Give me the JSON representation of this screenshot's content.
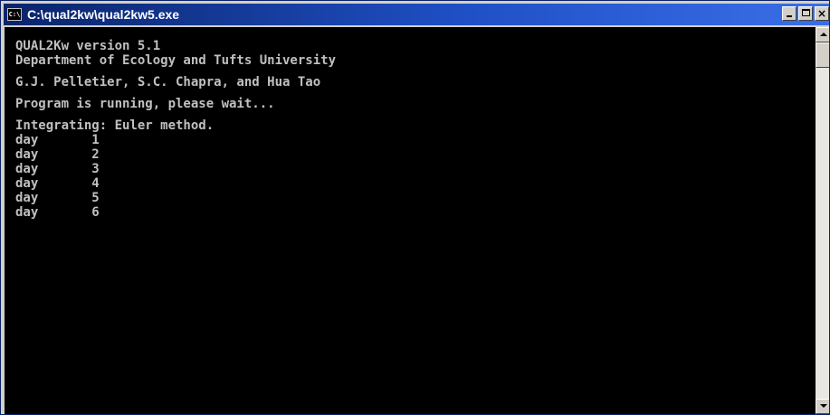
{
  "window": {
    "title": "C:\\qual2kw\\qual2kw5.exe",
    "icon_name": "console-icon",
    "icon_text": "C:\\",
    "close_glyph": "×"
  },
  "console": {
    "header": [
      "QUAL2Kw version 5.1",
      "Department of Ecology and Tufts University"
    ],
    "authors": "G.J. Pelletier, S.C. Chapra, and Hua Tao",
    "status": "Program is running, please wait...",
    "method": "Integrating: Euler method.",
    "days": [
      "day       1",
      "day       2",
      "day       3",
      "day       4",
      "day       5",
      "day       6"
    ]
  },
  "colors": {
    "console_background": "#000000",
    "console_text": "#c0c0c0",
    "titlebar_start": "#0a246a",
    "titlebar_end": "#3a6ee8"
  }
}
